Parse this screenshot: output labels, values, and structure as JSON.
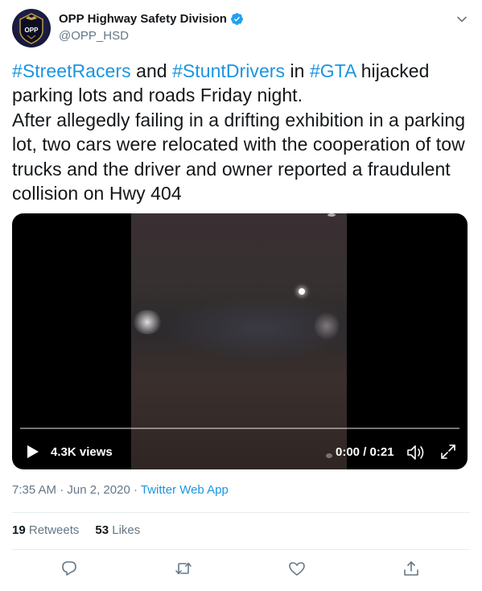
{
  "author": {
    "display_name": "OPP Highway Safety Division",
    "handle": "@OPP_HSD",
    "avatar_text": "OPP"
  },
  "tweet": {
    "hashtag_1": "#StreetRacers",
    "text_1": " and ",
    "hashtag_2": "#StuntDrivers",
    "text_2": " in ",
    "hashtag_3": "#GTA",
    "text_3": " hijacked parking lots and roads Friday night.",
    "text_4": "After allegedly failing in a drifting exhibition in a parking lot, two cars were relocated with the cooperation of tow trucks and the driver and owner reported a fraudulent collision on Hwy 404"
  },
  "video": {
    "views": "4.3K views",
    "time": "0:00 / 0:21",
    "progress": 0
  },
  "meta": {
    "time": "7:35 AM",
    "sep1": " · ",
    "date": "Jun 2, 2020",
    "sep2": " · ",
    "source": "Twitter Web App"
  },
  "stats": {
    "retweets_count": "19",
    "retweets_label": "Retweets",
    "likes_count": "53",
    "likes_label": "Likes"
  },
  "icons": {
    "reply": "reply-icon",
    "retweet": "retweet-icon",
    "like": "heart-icon",
    "share": "share-icon"
  },
  "colors": {
    "link": "#1b95e0",
    "secondary": "#657786",
    "verified": "#1da1f2"
  }
}
